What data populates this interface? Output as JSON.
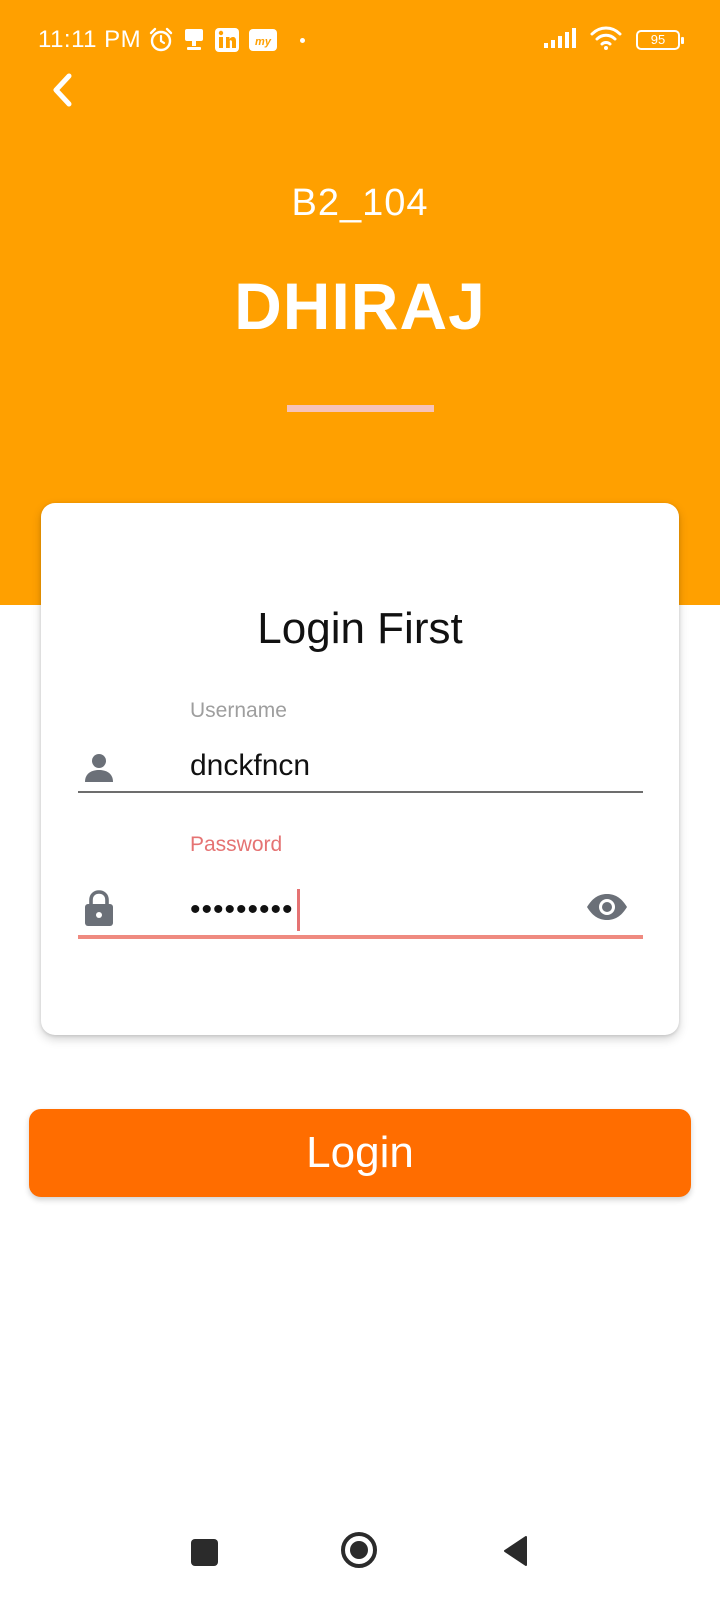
{
  "status_bar": {
    "time": "11:11 PM",
    "battery": "95",
    "notification_icons": [
      "alarm-icon",
      "notification-pin-icon",
      "linkedin-icon",
      "my-app-icon"
    ]
  },
  "header": {
    "unit_code": "B2_104",
    "resident_name": "DHIRAJ"
  },
  "login_card": {
    "title": "Login First",
    "username": {
      "label": "Username",
      "value": "dnckfncn",
      "icon": "person-icon"
    },
    "password": {
      "label": "Password",
      "masked_value": "•••••••••",
      "icon": "lock-icon",
      "toggle_icon": "eye-icon"
    }
  },
  "actions": {
    "login_label": "Login"
  },
  "colors": {
    "header_orange": "#FFA000",
    "button_orange": "#FF6D00",
    "focus_red": "#E57373",
    "divider_pink": "#F7C3B9"
  },
  "nav_bar": {
    "icons": [
      "recents-icon",
      "home-icon",
      "back-triangle-icon"
    ]
  }
}
